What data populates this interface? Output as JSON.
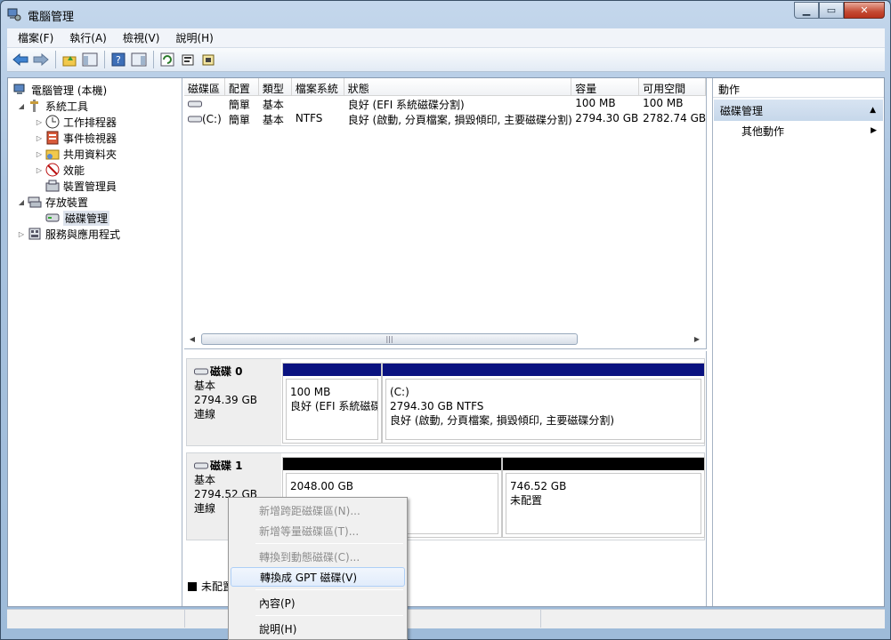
{
  "window": {
    "title": "電腦管理",
    "icon": "computer-management-icon"
  },
  "menu": [
    "檔案(F)",
    "執行(A)",
    "檢視(V)",
    "說明(H)"
  ],
  "tree": {
    "root": "電腦管理 (本機)",
    "system_tools": "系統工具",
    "task_scheduler": "工作排程器",
    "event_viewer": "事件檢視器",
    "shared_folders": "共用資料夾",
    "performance": "效能",
    "device_manager": "裝置管理員",
    "storage": "存放裝置",
    "disk_management": "磁碟管理",
    "services": "服務與應用程式"
  },
  "volume_list": {
    "headers": [
      "磁碟區",
      "配置",
      "類型",
      "檔案系統",
      "狀態",
      "容量",
      "可用空間"
    ],
    "rows": [
      {
        "volume": "",
        "layout": "簡單",
        "type": "基本",
        "fs": "",
        "status": "良好 (EFI 系統磁碟分割)",
        "capacity": "100 MB",
        "free": "100 MB"
      },
      {
        "volume": "(C:)",
        "layout": "簡單",
        "type": "基本",
        "fs": "NTFS",
        "status": "良好 (啟動, 分頁檔案, 損毀傾印, 主要磁碟分割)",
        "capacity": "2794.30 GB",
        "free": "2782.74 GB"
      }
    ]
  },
  "disks": [
    {
      "name": "磁碟 0",
      "type": "基本",
      "size": "2794.39 GB",
      "state": "連線",
      "parts": [
        {
          "title": "",
          "size": "100 MB",
          "status": "良好 (EFI 系統磁碟",
          "color": "#0a1280"
        },
        {
          "title": "(C:)",
          "size": "2794.30 GB NTFS",
          "status": "良好 (啟動, 分頁檔案, 損毀傾印, 主要磁碟分割)",
          "color": "#0a1280"
        }
      ]
    },
    {
      "name": "磁碟 1",
      "type": "基本",
      "size": "2794.52 GB",
      "state": "連線",
      "parts": [
        {
          "title": "",
          "size": "2048.00 GB",
          "status": "",
          "color": "#000000"
        },
        {
          "title": "",
          "size": "746.52 GB",
          "status": "未配置",
          "color": "#000000"
        }
      ]
    }
  ],
  "legend": {
    "unallocated": "未配置"
  },
  "actions": {
    "header": "動作",
    "section": "磁碟管理",
    "more": "其他動作"
  },
  "context_menu": {
    "new_spanned": "新增跨距磁碟區(N)...",
    "new_striped": "新增等量磁碟區(T)...",
    "convert_dynamic": "轉換到動態磁碟(C)...",
    "convert_gpt": "轉換成 GPT 磁碟(V)",
    "properties": "內容(P)",
    "help": "說明(H)"
  },
  "colors": {
    "primary_partition": "#0a1280",
    "unallocated": "#000000"
  }
}
